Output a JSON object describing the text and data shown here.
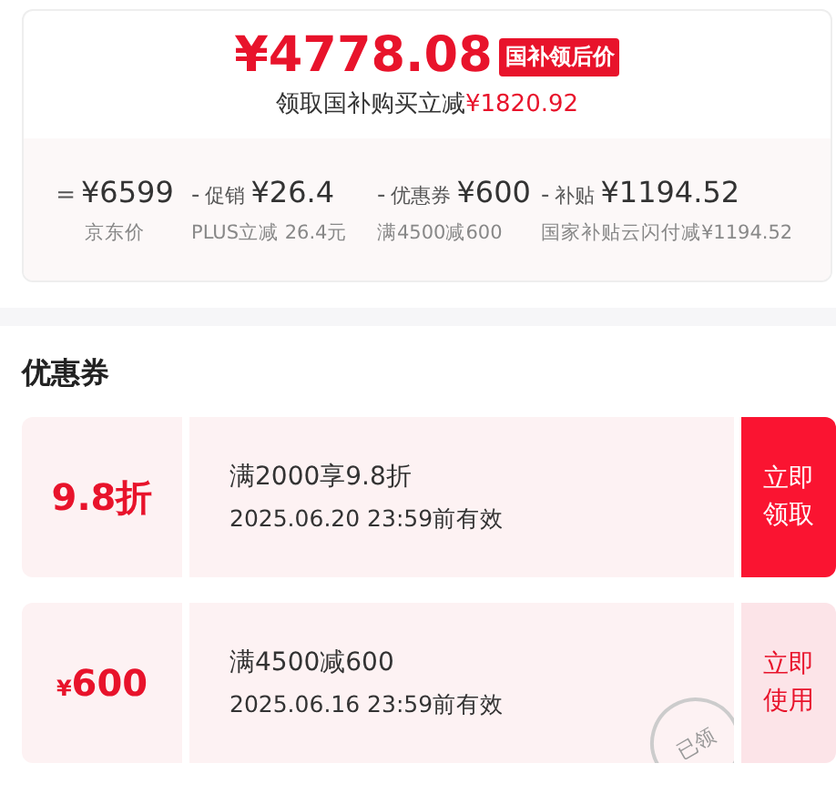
{
  "price_card": {
    "price": "¥4778.08",
    "price_tag": "国补领后价",
    "subtitle": "领取国补购买立减",
    "subtitle_amount": "¥1820.92",
    "breakdown": [
      {
        "op": "=",
        "amount": "¥6599",
        "note": "京东价"
      },
      {
        "op": "-",
        "label": "促销",
        "amount": "¥26.4",
        "note": "PLUS立减 26.4元"
      },
      {
        "op": "-",
        "label": "优惠券",
        "amount": "¥600",
        "note": "满4500减600"
      },
      {
        "op": "-",
        "label": "补贴",
        "amount": "¥1194.52",
        "note": "国家补贴云闪付减¥1194.52"
      }
    ]
  },
  "coupons_section": {
    "title": "优惠券",
    "coupons": [
      {
        "value": "9.8折",
        "condition": "满2000享9.8折",
        "validity": "2025.06.20 23:59前有效",
        "action": "立即领取",
        "claimed": false
      },
      {
        "symbol": "¥",
        "value": "600",
        "condition": "满4500减600",
        "validity": "2025.06.16 23:59前有效",
        "action": "立即使用",
        "claimed": true,
        "stamp": "已领"
      }
    ]
  }
}
